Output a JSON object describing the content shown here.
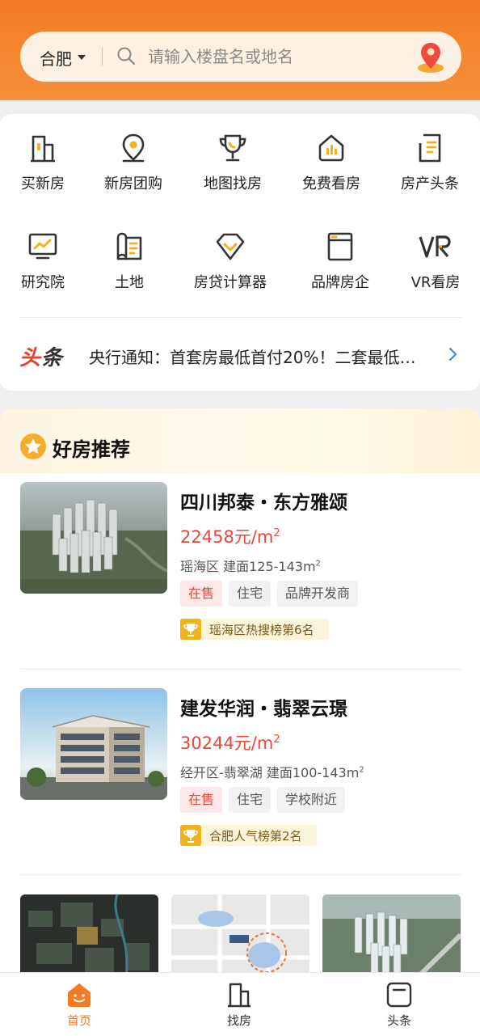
{
  "search": {
    "city": "合肥",
    "placeholder": "请输入楼盘名或地名"
  },
  "grid": [
    {
      "label": "买新房",
      "icon": "building-icon"
    },
    {
      "label": "新房团购",
      "icon": "location-pin-icon"
    },
    {
      "label": "地图找房",
      "icon": "trophy-icon"
    },
    {
      "label": "免费看房",
      "icon": "house-chart-icon"
    },
    {
      "label": "房产头条",
      "icon": "document-icon"
    },
    {
      "label": "研究院",
      "icon": "monitor-chart-icon"
    },
    {
      "label": "土地",
      "icon": "map-scroll-icon"
    },
    {
      "label": "房贷计算器",
      "icon": "diamond-icon"
    },
    {
      "label": "品牌房企",
      "icon": "window-icon"
    },
    {
      "label": "VR看房",
      "icon": "vr-icon"
    }
  ],
  "news": {
    "tag_red": "头",
    "tag_dark": "条",
    "text": "央行通知：首套房最低首付20%！二套最低…"
  },
  "section": {
    "title": "好房推荐"
  },
  "listings": [
    {
      "name": "四川邦泰・东方雅颂",
      "price": "22458元/m",
      "price_sup": "2",
      "meta": "瑶海区 建面125-143m",
      "meta_sup": "2",
      "tags": [
        "在售",
        "住宅",
        "品牌开发商"
      ],
      "rank": "瑶海区热搜榜第6名"
    },
    {
      "name": "建发华润・翡翠云璟",
      "price": "30244元/m",
      "price_sup": "2",
      "meta": "经开区-翡翠湖 建面100-143m",
      "meta_sup": "2",
      "tags": [
        "在售",
        "住宅",
        "学校附近"
      ],
      "rank": "合肥人气榜第2名"
    }
  ],
  "tabs": [
    {
      "label": "首页",
      "active": true
    },
    {
      "label": "找房",
      "active": false
    },
    {
      "label": "头条",
      "active": false
    }
  ],
  "colors": {
    "brand": "#f47a24",
    "price": "#e5473a",
    "icon_gold": "#f2b21b"
  }
}
